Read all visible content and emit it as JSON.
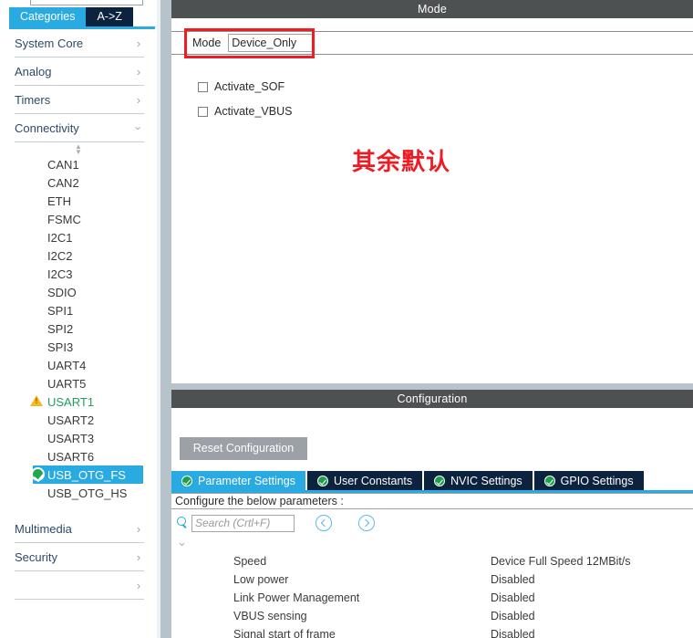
{
  "sidebar": {
    "tabs": [
      {
        "label": "Categories",
        "active": true
      },
      {
        "label": "A->Z",
        "active": false
      }
    ],
    "categories_top": [
      {
        "label": "System Core",
        "expanded": false
      },
      {
        "label": "Analog",
        "expanded": false
      },
      {
        "label": "Timers",
        "expanded": false
      },
      {
        "label": "Connectivity",
        "expanded": true
      }
    ],
    "peripherals": [
      {
        "label": "CAN1",
        "state": "none"
      },
      {
        "label": "CAN2",
        "state": "none"
      },
      {
        "label": "ETH",
        "state": "none"
      },
      {
        "label": "FSMC",
        "state": "none"
      },
      {
        "label": "I2C1",
        "state": "none"
      },
      {
        "label": "I2C2",
        "state": "none"
      },
      {
        "label": "I2C3",
        "state": "none"
      },
      {
        "label": "SDIO",
        "state": "none"
      },
      {
        "label": "SPI1",
        "state": "none"
      },
      {
        "label": "SPI2",
        "state": "none"
      },
      {
        "label": "SPI3",
        "state": "none"
      },
      {
        "label": "UART4",
        "state": "none"
      },
      {
        "label": "UART5",
        "state": "none"
      },
      {
        "label": "USART1",
        "state": "warning"
      },
      {
        "label": "USART2",
        "state": "none"
      },
      {
        "label": "USART3",
        "state": "none"
      },
      {
        "label": "USART6",
        "state": "none"
      },
      {
        "label": "USB_OTG_FS",
        "state": "selected"
      },
      {
        "label": "USB_OTG_HS",
        "state": "none"
      }
    ],
    "categories_bottom": [
      {
        "label": "Multimedia",
        "expanded": false
      },
      {
        "label": "Security",
        "expanded": false
      }
    ]
  },
  "mode": {
    "title": "Mode",
    "mode_label": "Mode",
    "mode_value": "Device_Only",
    "checkboxes": [
      {
        "label": "Activate_SOF",
        "checked": false
      },
      {
        "label": "Activate_VBUS",
        "checked": false
      }
    ],
    "annotation": "其余默认"
  },
  "configuration": {
    "title": "Configuration",
    "reset_label": "Reset Configuration",
    "tabs": [
      {
        "label": "Parameter Settings",
        "active": true
      },
      {
        "label": "User Constants",
        "active": false
      },
      {
        "label": "NVIC Settings",
        "active": false
      },
      {
        "label": "GPIO Settings",
        "active": false
      }
    ],
    "subheader": "Configure the below parameters :",
    "search_placeholder": "Search (Crtl+F)",
    "parameters": [
      {
        "name": "Speed",
        "value": "Device Full Speed 12MBit/s"
      },
      {
        "name": "Low power",
        "value": "Disabled"
      },
      {
        "name": "Link Power Management",
        "value": "Disabled"
      },
      {
        "name": "VBUS sensing",
        "value": "Disabled"
      },
      {
        "name": "Signal start of frame",
        "value": "Disabled"
      }
    ]
  },
  "colors": {
    "accent_blue": "#29abe2",
    "navy": "#0c2340",
    "panel_header": "#4e5152",
    "highlight_red": "#ee1c23",
    "ok_green": "#22a64e",
    "warn_yellow": "#f5b921",
    "splitter": "#b7c3cb"
  }
}
